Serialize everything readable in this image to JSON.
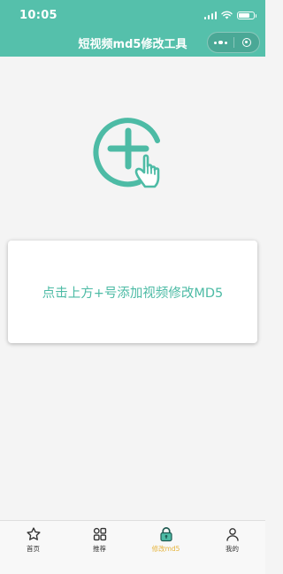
{
  "status_bar": {
    "time": "10:05"
  },
  "nav": {
    "title": "短视频md5修改工具"
  },
  "main": {
    "prompt": "点击上方+号添加视频修改MD5"
  },
  "tabs": [
    {
      "label": "首页",
      "icon": "star-icon",
      "active": false
    },
    {
      "label": "推荐",
      "icon": "grid-icon",
      "active": false
    },
    {
      "label": "修改md5",
      "icon": "lock-icon",
      "active": true
    },
    {
      "label": "我的",
      "icon": "user-icon",
      "active": false
    }
  ],
  "colors": {
    "primary": "#55c0ab",
    "accent_text": "#4dbba5",
    "active_tab": "#e6b43c"
  }
}
